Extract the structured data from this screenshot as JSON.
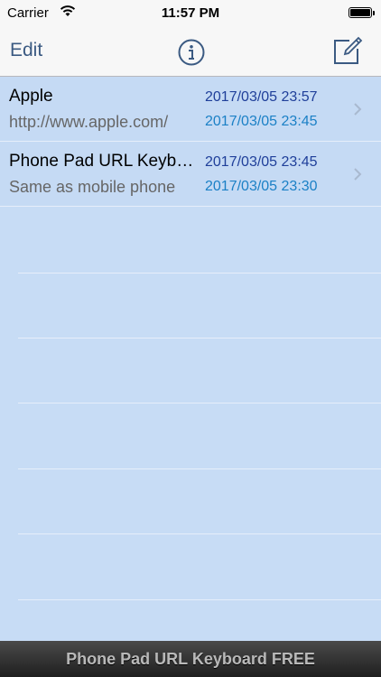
{
  "status_bar": {
    "carrier": "Carrier",
    "time": "11:57 PM"
  },
  "nav": {
    "edit_label": "Edit",
    "info_icon": "info-circle-icon",
    "compose_icon": "compose-icon"
  },
  "list": {
    "rows": [
      {
        "title": "Apple",
        "subtitle": "http://www.apple.com/",
        "date_modified": "2017/03/05 23:57",
        "date_created": "2017/03/05 23:45"
      },
      {
        "title": "Phone Pad URL Keyboard",
        "subtitle": "Same as mobile phone",
        "date_modified": "2017/03/05 23:45",
        "date_created": "2017/03/05 23:30"
      }
    ]
  },
  "banner": {
    "text": "Phone Pad URL Keyboard FREE"
  },
  "colors": {
    "list_background": "#c7dcf5",
    "accent": "#3b5a82",
    "date_primary": "#1f3f9a",
    "date_secondary": "#1b80c6"
  }
}
